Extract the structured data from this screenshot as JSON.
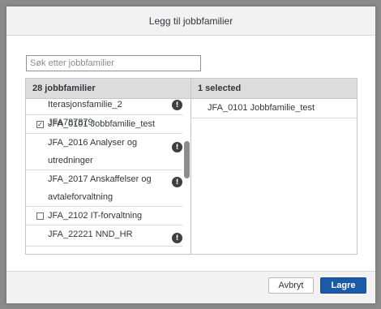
{
  "dialog": {
    "title": "Legg til jobbfamilier",
    "search_placeholder": "Søk etter jobbfamilier"
  },
  "left": {
    "header": "28 jobbfamilier",
    "items": [
      {
        "line1": "Iterasjonsfamilie_2 JFA787879",
        "line2": "",
        "checkbox": "none",
        "warning": true
      },
      {
        "line1": "JFA_0101 Jobbfamilie_test",
        "line2": "",
        "checkbox": "checked",
        "warning": false
      },
      {
        "line1": "JFA_2016 Analyser og",
        "line2": "utredninger",
        "checkbox": "none",
        "warning": true
      },
      {
        "line1": "JFA_2017 Anskaffelser og",
        "line2": "avtaleforvaltning",
        "checkbox": "none",
        "warning": true
      },
      {
        "line1": "JFA_2102 IT-forvaltning",
        "line2": "",
        "checkbox": "unchecked",
        "warning": false
      },
      {
        "line1": "JFA_22221 NND_HR",
        "line2": "",
        "checkbox": "none",
        "warning": true
      }
    ]
  },
  "right": {
    "header": "1 selected",
    "items": [
      {
        "label": "JFA_0101 Jobbfamilie_test"
      }
    ]
  },
  "footer": {
    "cancel_label": "Avbryt",
    "save_label": "Lagre"
  },
  "icons": {
    "warning": "exclamation-circle-icon",
    "check": "checkmark-icon"
  },
  "colors": {
    "primary_button": "#1b5ba6",
    "header_bg": "#f2f2f2",
    "column_header_bg": "#dcdcdc"
  }
}
